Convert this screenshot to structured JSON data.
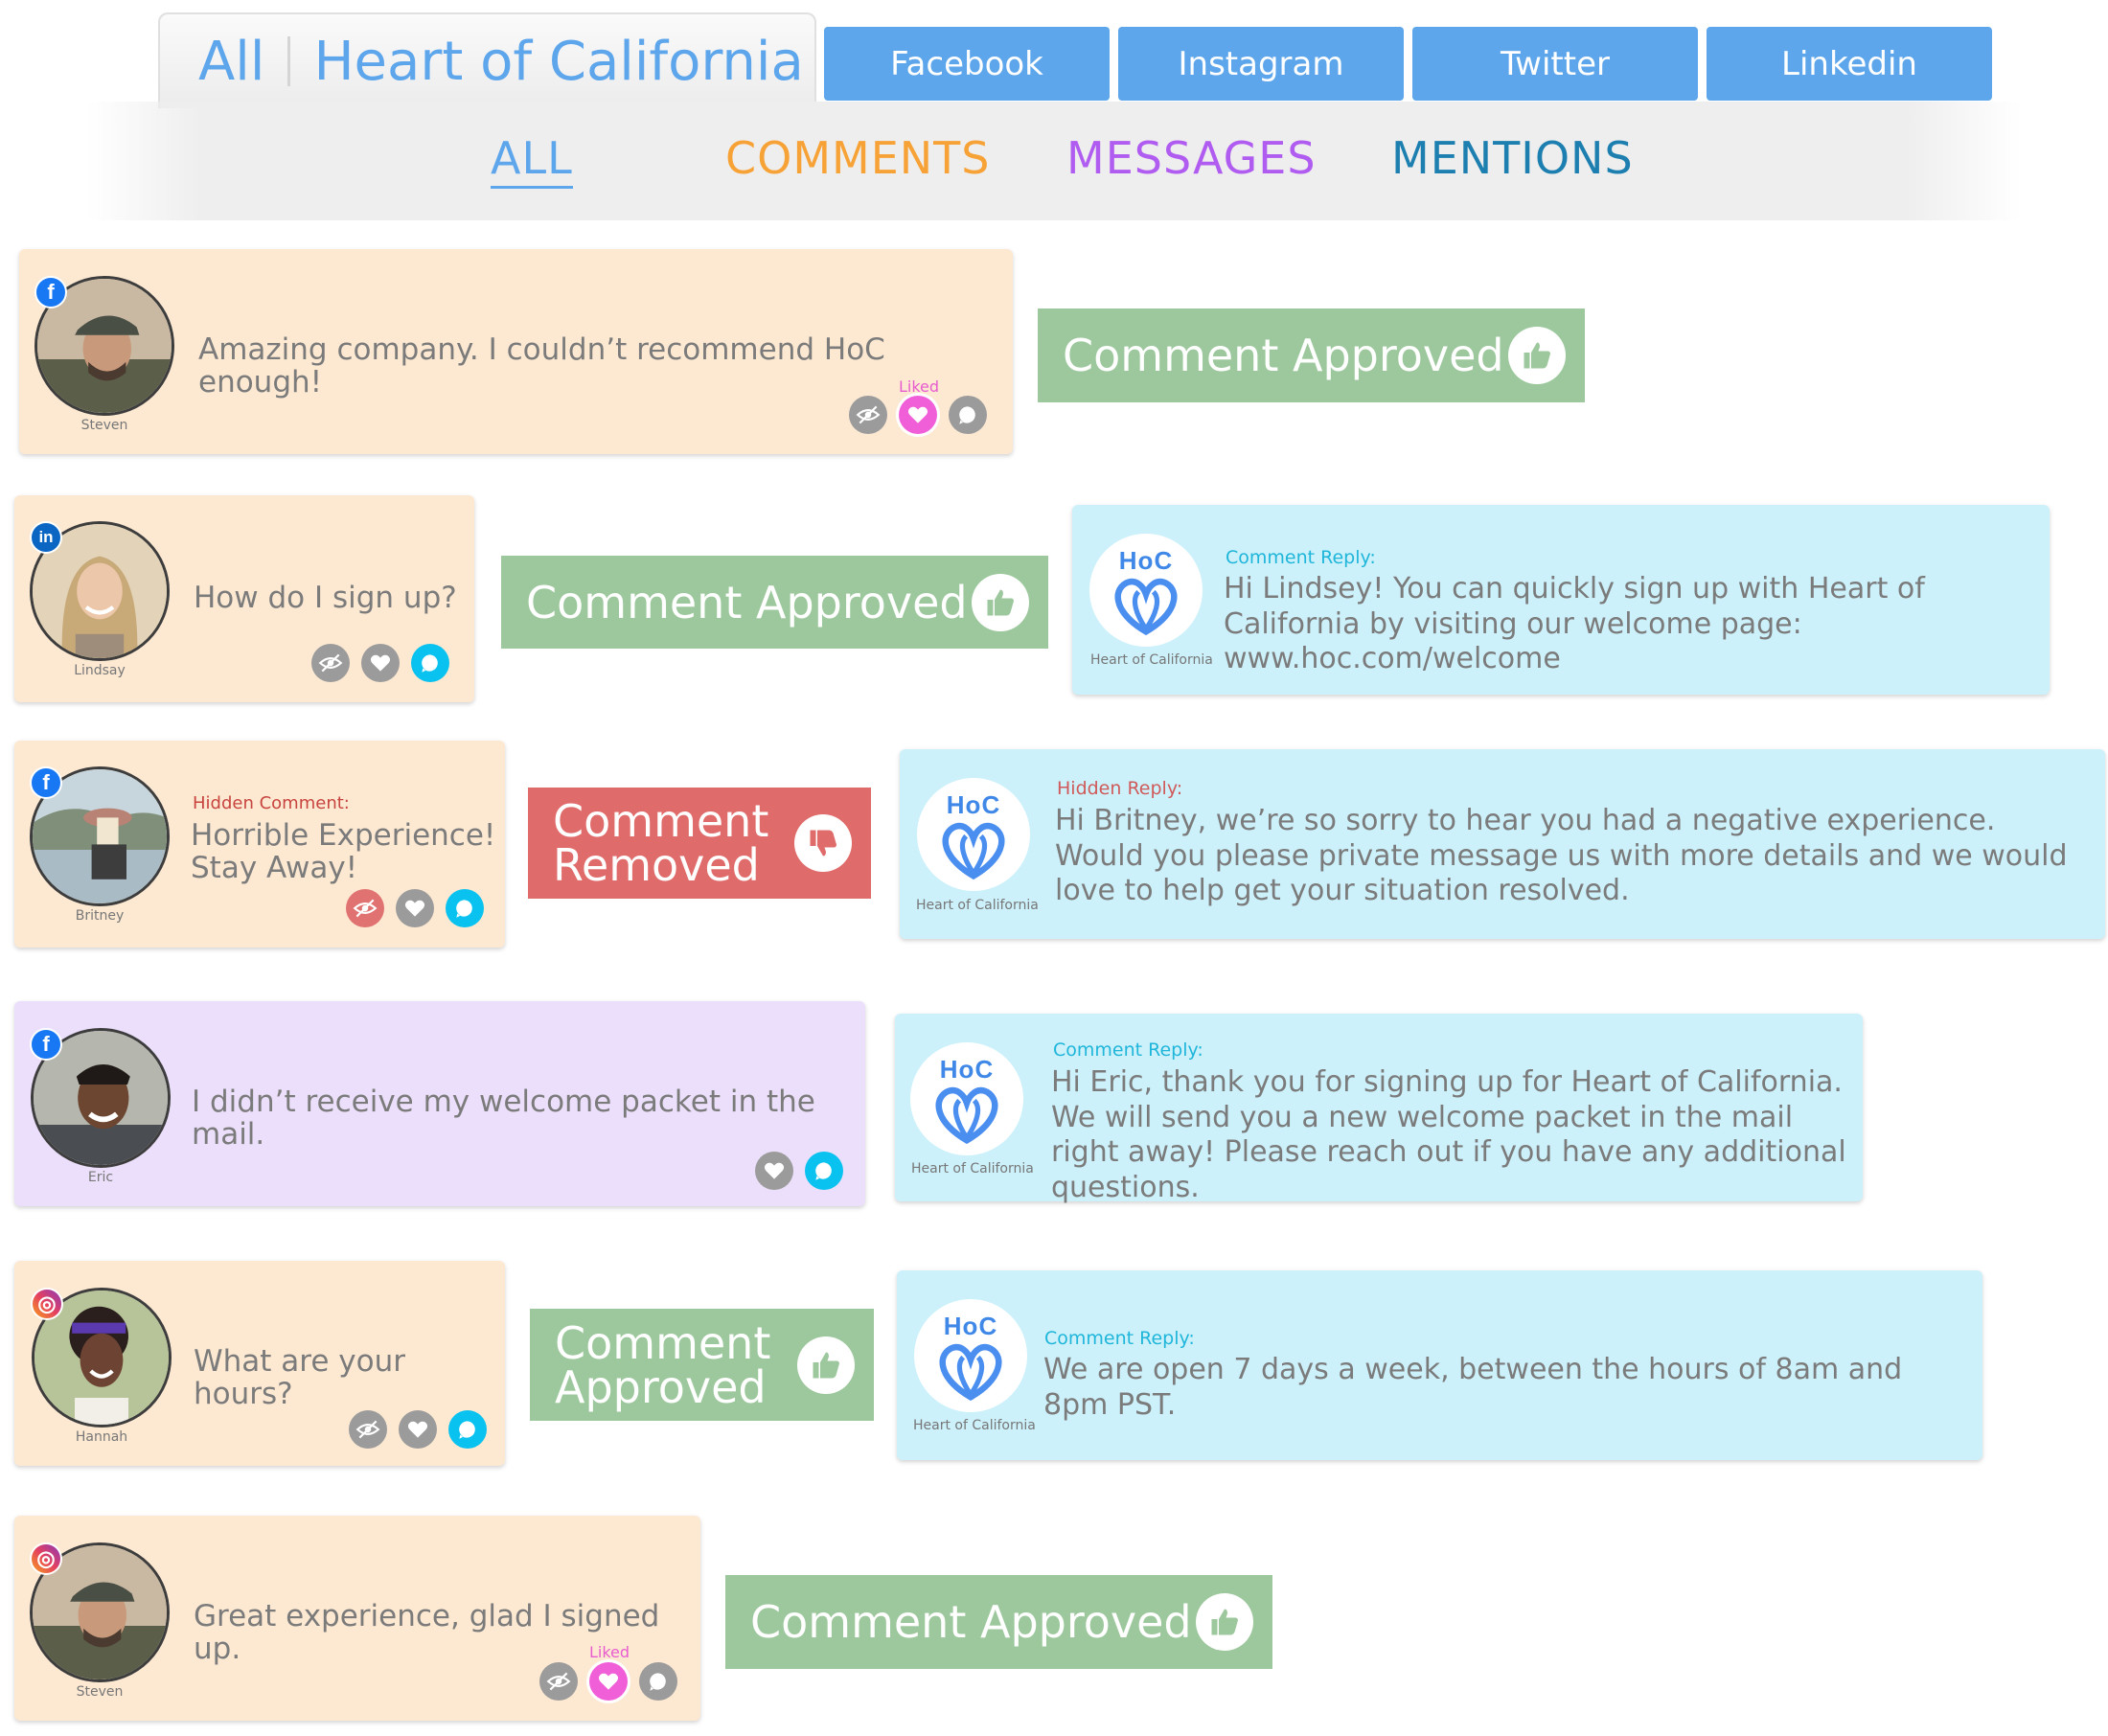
{
  "header": {
    "scope": "All",
    "org_name": "Heart of California",
    "networks": [
      "Facebook",
      "Instagram",
      "Twitter",
      "Linkedin"
    ],
    "filters": [
      {
        "label": "ALL",
        "color": "#5ea6ec"
      },
      {
        "label": "COMMENTS",
        "color": "#f7a237"
      },
      {
        "label": "MESSAGES",
        "color": "#b05cf0"
      },
      {
        "label": "MENTIONS",
        "color": "#1d7fb0"
      }
    ]
  },
  "liked_label": "Liked",
  "icons": {
    "hide": "eye-slash-icon",
    "like": "heart-icon",
    "reply": "chat-bubble-icon",
    "approve": "thumbs-up-icon",
    "remove": "thumbs-down-icon",
    "logo": "hoc-heart-logo"
  },
  "colors": {
    "peach_card": "#fde9d2",
    "lilac_card": "#ecdffb",
    "reply_card": "#ccf1fb",
    "approved": "#9dc89d",
    "removed": "#e06b6b",
    "liked": "#f15fd8",
    "reply_active": "#09c2f0"
  },
  "items": [
    {
      "network": "facebook",
      "user": "Steven",
      "comment": "Amazing company. I couldn’t recommend HoC enough!",
      "liked": true,
      "status": "Comment Approved"
    },
    {
      "network": "linkedin",
      "user": "Lindsay",
      "comment": "How do I sign up?",
      "status": "Comment Approved",
      "reply": {
        "label": "Comment Reply:",
        "org": "Heart of California",
        "logo_text": "HoC",
        "text": "Hi Lindsey! You can quickly sign up with Heart of California by visiting our welcome page: www.hoc.com/welcome"
      }
    },
    {
      "network": "facebook",
      "user": "Britney",
      "hidden_label": "Hidden Comment:",
      "comment": "Horrible Experience! Stay Away!",
      "status": "Comment Removed",
      "reply": {
        "label": "Hidden Reply:",
        "org": "Heart of California",
        "logo_text": "HoC",
        "text": "Hi Britney, we’re so sorry to hear you had a negative experience. Would you please private message us with more details and we would love to help get your situation resolved."
      }
    },
    {
      "network": "facebook",
      "user": "Eric",
      "comment": "I didn’t receive my welcome packet in the mail.",
      "reply": {
        "label": "Comment Reply:",
        "org": "Heart of California",
        "logo_text": "HoC",
        "text": "Hi Eric, thank you for signing up for Heart of California. We will send you a new welcome packet in the mail right away! Please reach out if you have any additional questions."
      }
    },
    {
      "network": "instagram",
      "user": "Hannah",
      "comment": "What are your hours?",
      "status": "Comment Approved",
      "reply": {
        "label": "Comment Reply:",
        "org": "Heart of California",
        "logo_text": "HoC",
        "text": "We are open 7 days a week, between the hours of 8am and 8pm PST."
      }
    },
    {
      "network": "instagram",
      "user": "Steven",
      "comment": "Great experience, glad I signed up.",
      "liked": true,
      "status": "Comment Approved"
    }
  ]
}
